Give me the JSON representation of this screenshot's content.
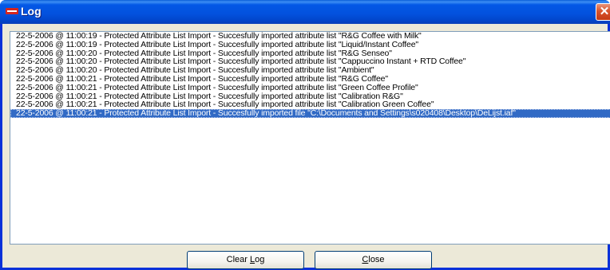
{
  "window": {
    "title": "Log"
  },
  "log": {
    "entries": [
      "22-5-2006 @ 11:00:19 - Protected Attribute List Import - Succesfully imported attribute list \"R&G Coffee with Milk\"",
      "22-5-2006 @ 11:00:19 - Protected Attribute List Import - Succesfully imported attribute list \"Liquid/Instant Coffee\"",
      "22-5-2006 @ 11:00:20 - Protected Attribute List Import - Succesfully imported attribute list \"R&G Senseo\"",
      "22-5-2006 @ 11:00:20 - Protected Attribute List Import - Succesfully imported attribute list \"Cappuccino Instant + RTD Coffee\"",
      "22-5-2006 @ 11:00:20 - Protected Attribute List Import - Succesfully imported attribute list \"Ambient\"",
      "22-5-2006 @ 11:00:21 - Protected Attribute List Import - Succesfully imported attribute list \"R&G Coffee\"",
      "22-5-2006 @ 11:00:21 - Protected Attribute List Import - Succesfully imported attribute list \"Green Coffee Profile\"",
      "22-5-2006 @ 11:00:21 - Protected Attribute List Import - Succesfully imported attribute list \"Calibration R&G\"",
      "22-5-2006 @ 11:00:21 - Protected Attribute List Import - Succesfully imported attribute list \"Calibration Green Coffee\"",
      "22-5-2006 @ 11:00:21 - Protected Attribute List Import - Succesfully imported file \"C:\\Documents and Settings\\s020408\\Desktop\\DeLijst.iaf\""
    ],
    "selected_index": 9
  },
  "buttons": {
    "clear_log": {
      "before": "Clear ",
      "mnemonic": "L",
      "after": "og"
    },
    "close": {
      "before": "",
      "mnemonic": "C",
      "after": "lose"
    }
  },
  "colors": {
    "titlebar": "#0358e6",
    "selection": "#316ac5",
    "close_button": "#d8532c"
  },
  "icons": {
    "app": "app-icon",
    "close": "close-icon"
  }
}
